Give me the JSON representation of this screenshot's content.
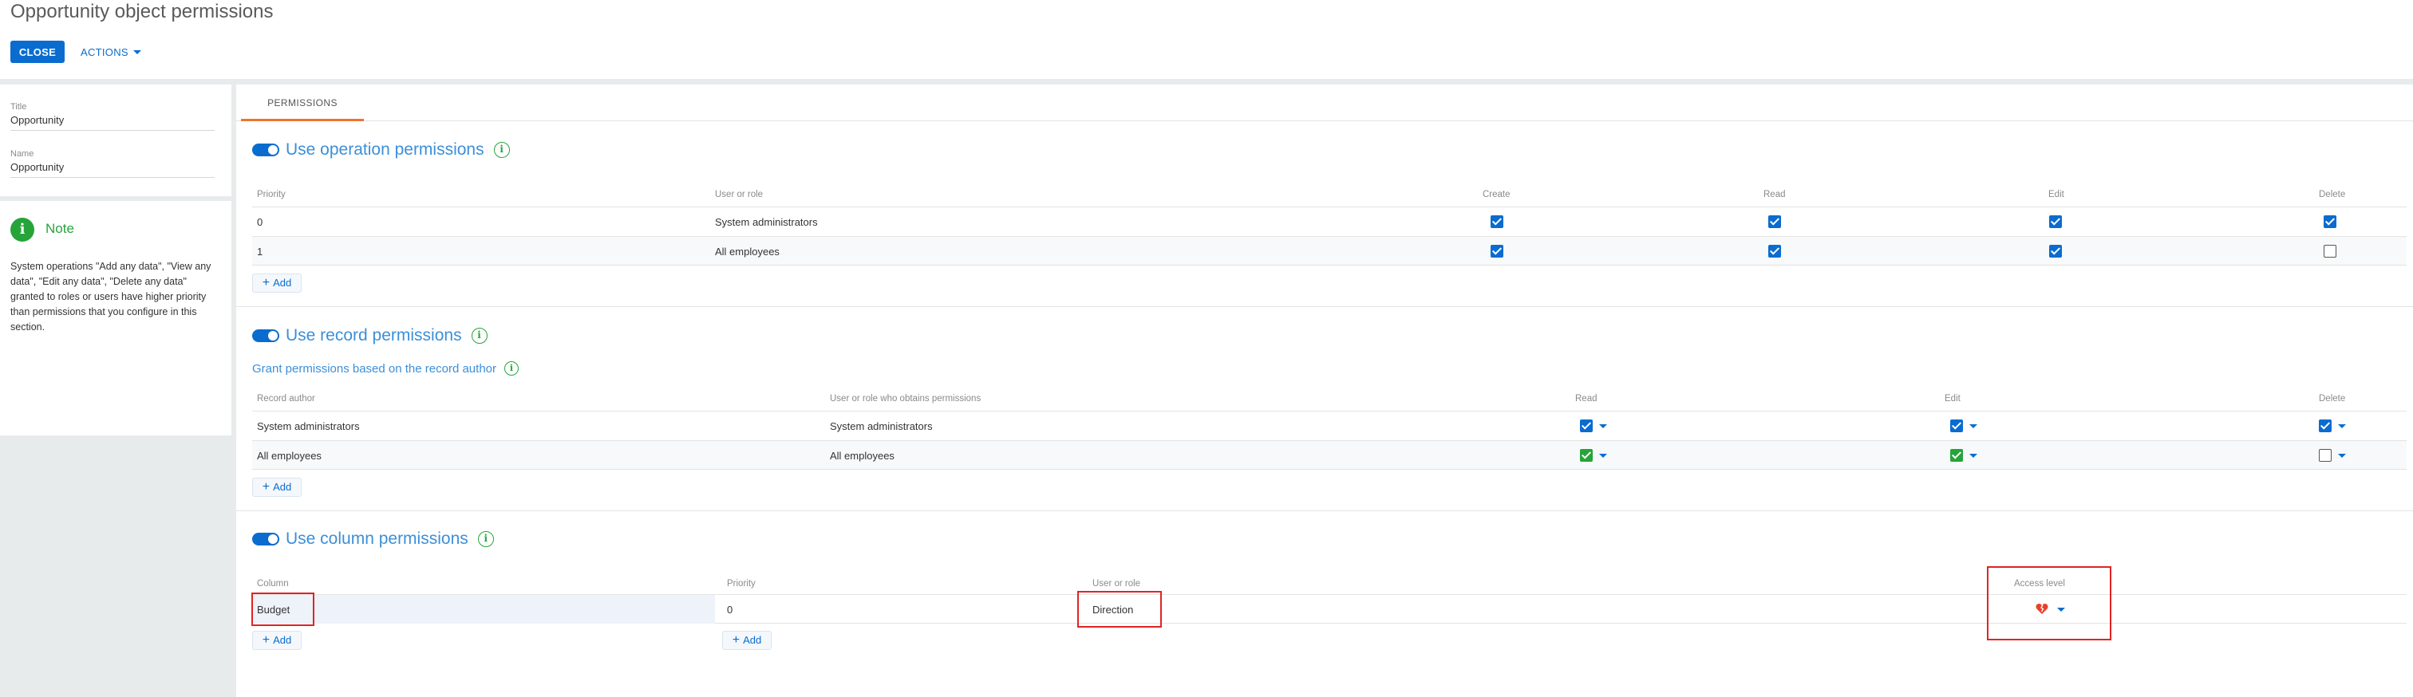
{
  "header": {
    "title": "Opportunity object permissions",
    "close_label": "CLOSE",
    "actions_label": "ACTIONS"
  },
  "sidebar": {
    "fields": [
      {
        "label": "Title",
        "value": "Opportunity"
      },
      {
        "label": "Name",
        "value": "Opportunity"
      }
    ],
    "note": {
      "icon": "info-icon",
      "icon_glyph": "i",
      "title": "Note",
      "text": "System operations \"Add any data\", \"View any data\", \"Edit any data\", \"Delete any data\" granted to roles or users have higher priority than permissions that you configure in this section."
    }
  },
  "tabs": [
    {
      "label": "PERMISSIONS",
      "active": true
    }
  ],
  "operation_permissions": {
    "title": "Use operation permissions",
    "enabled": true,
    "columns": [
      "Priority",
      "User or role",
      "Create",
      "Read",
      "Edit",
      "Delete"
    ],
    "rows": [
      {
        "priority": "0",
        "role": "System administrators",
        "create": true,
        "read": true,
        "edit": true,
        "delete": true
      },
      {
        "priority": "1",
        "role": "All employees",
        "create": true,
        "read": true,
        "edit": true,
        "delete": false
      }
    ],
    "add_label": "Add"
  },
  "record_permissions": {
    "title": "Use record permissions",
    "enabled": true,
    "sub_link": "Grant permissions based on the record author",
    "columns": [
      "Record author",
      "User or role who obtains permissions",
      "Read",
      "Edit",
      "Delete"
    ],
    "rows": [
      {
        "author": "System administrators",
        "grantee": "System administrators",
        "read": "checked-blue",
        "edit": "checked-blue",
        "delete": "checked-blue"
      },
      {
        "author": "All employees",
        "grantee": "All employees",
        "read": "checked-green",
        "edit": "checked-green",
        "delete": "unchecked"
      }
    ],
    "add_label": "Add"
  },
  "column_permissions": {
    "title": "Use column permissions",
    "enabled": true,
    "columns": [
      "Column",
      "Priority",
      "User or role",
      "Access level"
    ],
    "column_rows": [
      {
        "column": "Budget"
      }
    ],
    "priority_rows": [
      {
        "priority": "0",
        "role": "Direction",
        "access_icon": "access-denied-icon"
      }
    ],
    "add_label": "Add"
  },
  "colors": {
    "accent": "#0a6ccf",
    "section_title": "#3c8fd8",
    "success": "#26a43a",
    "tab_underline": "#f0722d",
    "highlight": "#e02424"
  }
}
